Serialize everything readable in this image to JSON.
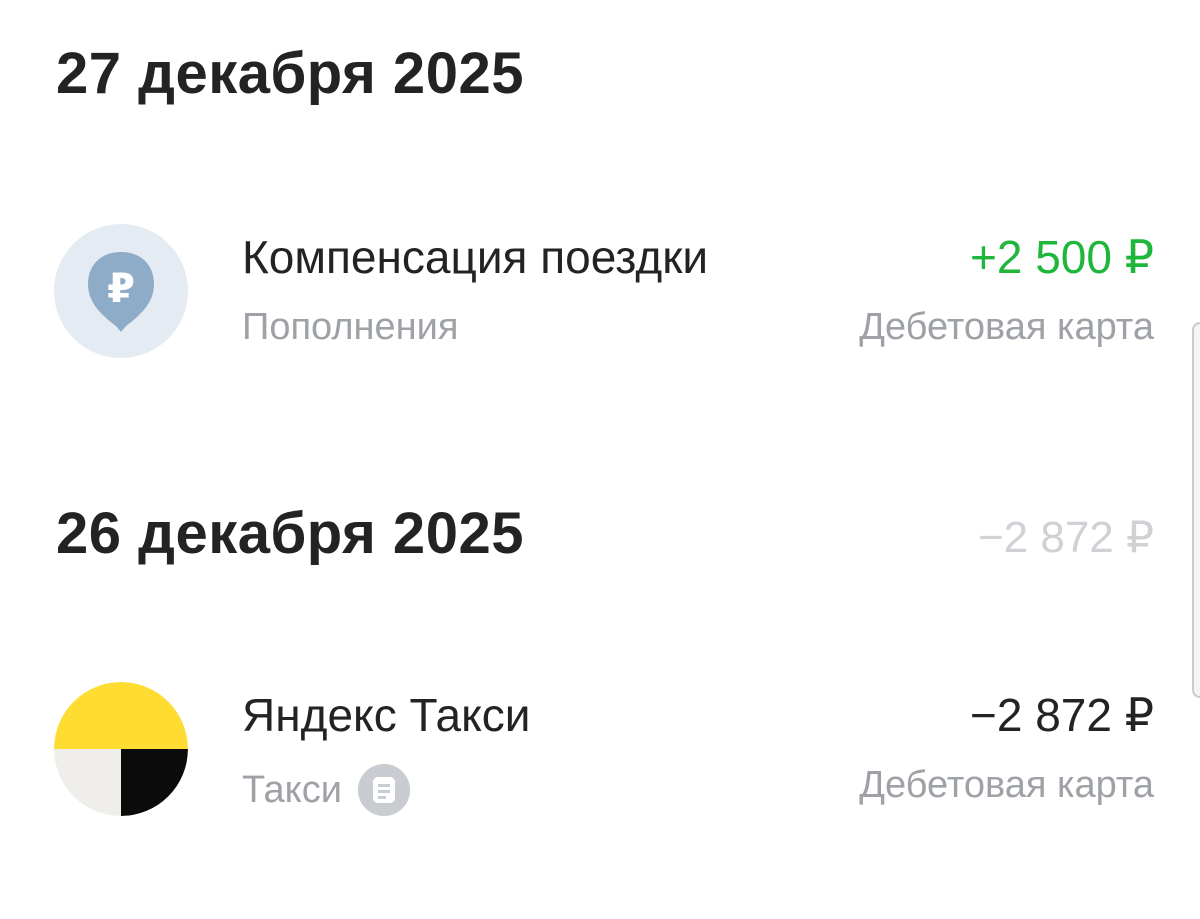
{
  "groups": [
    {
      "date": "27 декабря 2025",
      "total": "",
      "transactions": [
        {
          "title": "Компенсация поездки",
          "category": "Пополнения",
          "amount": "+2 500 ₽",
          "account": "Дебетовая карта",
          "icon": "ruble-pin-icon",
          "amount_color": "#1fb63c"
        }
      ]
    },
    {
      "date": "26 декабря 2025",
      "total": "−2 872 ₽",
      "transactions": [
        {
          "title": "Яндекс Такси",
          "category": "Такси",
          "amount": "−2 872 ₽",
          "account": "Дебетовая карта",
          "icon": "yandex-taxi-logo-icon",
          "has_receipt": true,
          "amount_color": "#232323"
        }
      ]
    }
  ],
  "colors": {
    "positive": "#1fb63c",
    "text": "#232323",
    "muted": "#9ea1a6",
    "day_total": "#cfd1d4",
    "taxi_yellow": "#fedc31",
    "avatar_bg": "#e4ebf3",
    "avatar_pin": "#8eabc7"
  }
}
